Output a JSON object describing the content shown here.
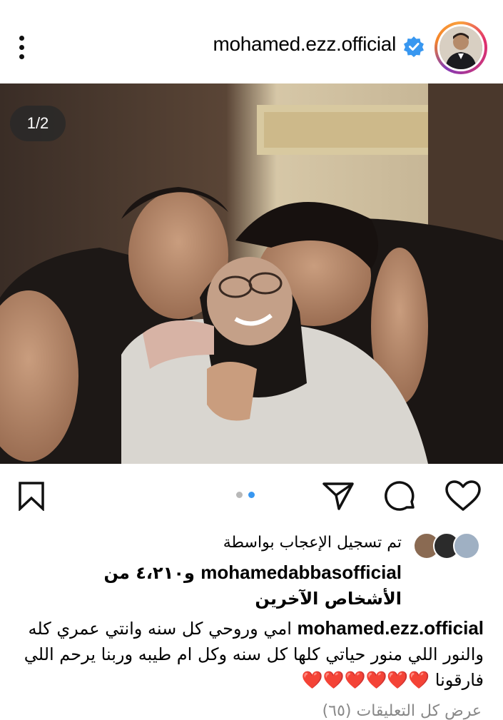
{
  "header": {
    "username": "mohamed.ezz.official",
    "menu_icon": "more-vertical-icon",
    "verified_icon": "verified-badge-icon",
    "accent": "#3897f0"
  },
  "post": {
    "slide_counter": "1/2",
    "carousel": {
      "total": 2,
      "active": 2
    }
  },
  "actions": {
    "like_icon": "heart-outline-icon",
    "comment_icon": "comment-icon",
    "share_icon": "send-icon",
    "save_icon": "bookmark-icon"
  },
  "likes": {
    "prefix": "تم تسجيل الإعجاب بواسطة",
    "liker": "mohamedabbasofficial",
    "suffix": "و٤،٢١٠ من الأشخاص الآخرين"
  },
  "caption": {
    "author": "mohamed.ezz.official",
    "text": "امي وروحي كل سنه وانتي عمري كله والنور اللي منور حياتي كلها كل سنه وكل ام طيبه وربنا يرحم اللي فارقونا",
    "hearts": "❤️❤️❤️❤️❤️❤️"
  },
  "comments": {
    "label": "عرض كل التعليقات (٦٥)"
  }
}
